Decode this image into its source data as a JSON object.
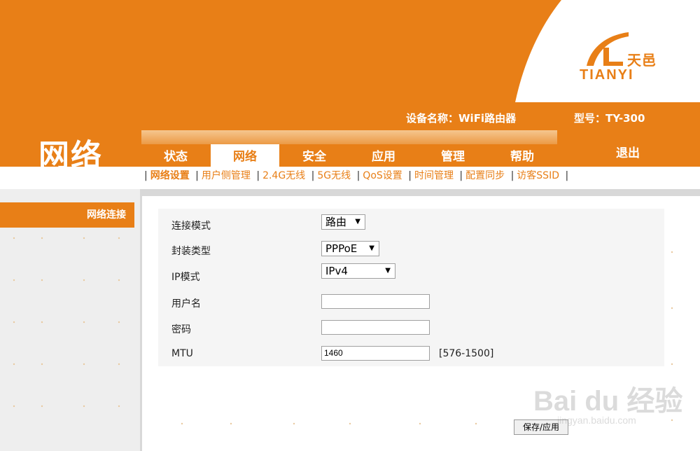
{
  "brand": {
    "name_cn": "天邑",
    "name_en": "TIANYI"
  },
  "header": {
    "device_name": "设备名称：WiFi路由器",
    "model": "型号：TY-300",
    "page_title": "网络",
    "logout_label": "退出"
  },
  "tabs": [
    {
      "label": "状态",
      "active": false
    },
    {
      "label": "网络",
      "active": true
    },
    {
      "label": "安全",
      "active": false
    },
    {
      "label": "应用",
      "active": false
    },
    {
      "label": "管理",
      "active": false
    },
    {
      "label": "帮助",
      "active": false
    }
  ],
  "subnav": [
    {
      "label": "网络设置",
      "active": true
    },
    {
      "label": "用户侧管理",
      "active": false
    },
    {
      "label": "2.4G无线",
      "active": false
    },
    {
      "label": "5G无线",
      "active": false
    },
    {
      "label": "QoS设置",
      "active": false
    },
    {
      "label": "时间管理",
      "active": false
    },
    {
      "label": "配置同步",
      "active": false
    },
    {
      "label": "访客SSID",
      "active": false
    }
  ],
  "sidebar": {
    "items": [
      {
        "label": "网络连接",
        "active": true
      }
    ]
  },
  "form": {
    "connection_mode": {
      "label": "连接模式",
      "value": "路由"
    },
    "encapsulation": {
      "label": "封装类型",
      "value": "PPPoE"
    },
    "ip_mode": {
      "label": "IP模式",
      "value": "IPv4"
    },
    "username": {
      "label": "用户名",
      "value": ""
    },
    "password": {
      "label": "密码",
      "value": ""
    },
    "mtu": {
      "label": "MTU",
      "value": "1460",
      "range": "[576-1500]"
    }
  },
  "actions": {
    "save_label": "保存/应用"
  },
  "watermark": {
    "main": "Bai du 经验",
    "sub": "jingyan.baidu.com"
  },
  "colors": {
    "accent": "#e87f17",
    "panel": "#f5f5f5",
    "sidebar_bg": "#eeeeee"
  }
}
